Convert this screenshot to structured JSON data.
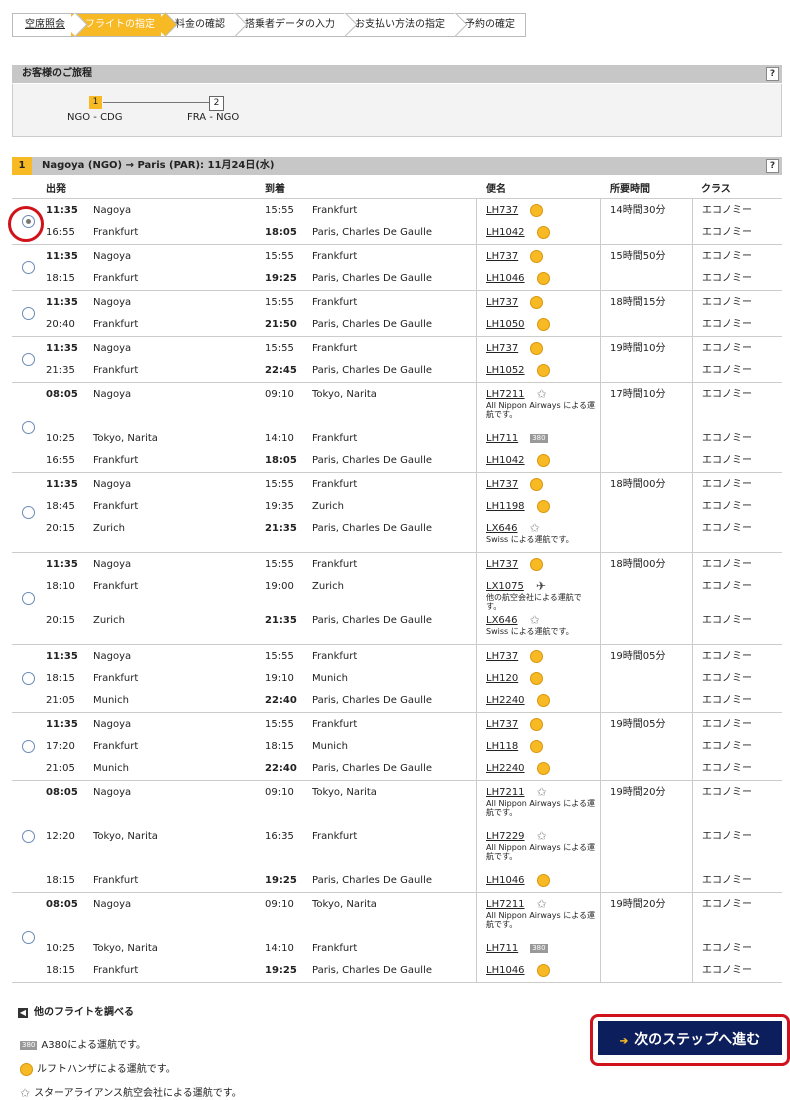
{
  "steps": [
    "空席照会",
    "フライトの指定",
    "料金の確認",
    "搭乗者データの入力",
    "お支払い方法の指定",
    "予約の確定"
  ],
  "itinerary": {
    "title": "お客様のご旅程",
    "help": "?",
    "segments": [
      {
        "num": "1",
        "route": "NGO - CDG"
      },
      {
        "num": "2",
        "route": "FRA - NGO"
      }
    ]
  },
  "flight_table": {
    "num": "1",
    "title": "Nagoya (NGO) → Paris (PAR):  11月24日(水)",
    "help": "?",
    "columns": {
      "dep": "出発",
      "arr": "到着",
      "flight": "便名",
      "duration": "所要時間",
      "class": "クラス"
    }
  },
  "options": [
    {
      "selected": true,
      "duration": "14時間30分",
      "legs": [
        {
          "dep_time": "11:35",
          "dep_city": "Nagoya",
          "arr_time": "15:55",
          "arr_city": "Frankfurt",
          "flight": "LH737",
          "icon": "lufthansa-icon",
          "class": "エコノミー",
          "dep_bold": true
        },
        {
          "dep_time": "16:55",
          "dep_city": "Frankfurt",
          "arr_time": "18:05",
          "arr_city": "Paris, Charles De Gaulle",
          "flight": "LH1042",
          "icon": "lufthansa-icon",
          "class": "エコノミー",
          "arr_bold": true
        }
      ]
    },
    {
      "selected": false,
      "duration": "15時間50分",
      "legs": [
        {
          "dep_time": "11:35",
          "dep_city": "Nagoya",
          "arr_time": "15:55",
          "arr_city": "Frankfurt",
          "flight": "LH737",
          "icon": "lufthansa-icon",
          "class": "エコノミー",
          "dep_bold": true
        },
        {
          "dep_time": "18:15",
          "dep_city": "Frankfurt",
          "arr_time": "19:25",
          "arr_city": "Paris, Charles De Gaulle",
          "flight": "LH1046",
          "icon": "lufthansa-icon",
          "class": "エコノミー",
          "arr_bold": true
        }
      ]
    },
    {
      "selected": false,
      "duration": "18時間15分",
      "legs": [
        {
          "dep_time": "11:35",
          "dep_city": "Nagoya",
          "arr_time": "15:55",
          "arr_city": "Frankfurt",
          "flight": "LH737",
          "icon": "lufthansa-icon",
          "class": "エコノミー",
          "dep_bold": true
        },
        {
          "dep_time": "20:40",
          "dep_city": "Frankfurt",
          "arr_time": "21:50",
          "arr_city": "Paris, Charles De Gaulle",
          "flight": "LH1050",
          "icon": "lufthansa-icon",
          "class": "エコノミー",
          "arr_bold": true
        }
      ]
    },
    {
      "selected": false,
      "duration": "19時間10分",
      "legs": [
        {
          "dep_time": "11:35",
          "dep_city": "Nagoya",
          "arr_time": "15:55",
          "arr_city": "Frankfurt",
          "flight": "LH737",
          "icon": "lufthansa-icon",
          "class": "エコノミー",
          "dep_bold": true
        },
        {
          "dep_time": "21:35",
          "dep_city": "Frankfurt",
          "arr_time": "22:45",
          "arr_city": "Paris, Charles De Gaulle",
          "flight": "LH1052",
          "icon": "lufthansa-icon",
          "class": "エコノミー",
          "arr_bold": true
        }
      ]
    },
    {
      "selected": false,
      "duration": "17時間10分",
      "legs": [
        {
          "dep_time": "08:05",
          "dep_city": "Nagoya",
          "arr_time": "09:10",
          "arr_city": "Tokyo, Narita",
          "flight": "LH7211",
          "icon": "star-alliance-icon",
          "note": "All Nippon Airways による運航です。",
          "class": "エコノミー",
          "dep_bold": true
        },
        {
          "dep_time": "10:25",
          "dep_city": "Tokyo, Narita",
          "arr_time": "14:10",
          "arr_city": "Frankfurt",
          "flight": "LH711",
          "icon": "a380-icon",
          "class": "エコノミー"
        },
        {
          "dep_time": "16:55",
          "dep_city": "Frankfurt",
          "arr_time": "18:05",
          "arr_city": "Paris, Charles De Gaulle",
          "flight": "LH1042",
          "icon": "lufthansa-icon",
          "class": "エコノミー",
          "arr_bold": true
        }
      ]
    },
    {
      "selected": false,
      "duration": "18時間00分",
      "legs": [
        {
          "dep_time": "11:35",
          "dep_city": "Nagoya",
          "arr_time": "15:55",
          "arr_city": "Frankfurt",
          "flight": "LH737",
          "icon": "lufthansa-icon",
          "class": "エコノミー",
          "dep_bold": true
        },
        {
          "dep_time": "18:45",
          "dep_city": "Frankfurt",
          "arr_time": "19:35",
          "arr_city": "Zurich",
          "flight": "LH1198",
          "icon": "lufthansa-icon",
          "class": "エコノミー"
        },
        {
          "dep_time": "20:15",
          "dep_city": "Zurich",
          "arr_time": "21:35",
          "arr_city": "Paris, Charles De Gaulle",
          "flight": "LX646",
          "icon": "star-alliance-icon",
          "note": "Swiss による運航です。",
          "class": "エコノミー",
          "arr_bold": true
        }
      ]
    },
    {
      "selected": false,
      "duration": "18時間00分",
      "legs": [
        {
          "dep_time": "11:35",
          "dep_city": "Nagoya",
          "arr_time": "15:55",
          "arr_city": "Frankfurt",
          "flight": "LH737",
          "icon": "lufthansa-icon",
          "class": "エコノミー",
          "dep_bold": true
        },
        {
          "dep_time": "18:10",
          "dep_city": "Frankfurt",
          "arr_time": "19:00",
          "arr_city": "Zurich",
          "flight": "LX1075",
          "icon": "plane-icon",
          "note": "他の航空会社による運航です。",
          "class": "エコノミー"
        },
        {
          "dep_time": "20:15",
          "dep_city": "Zurich",
          "arr_time": "21:35",
          "arr_city": "Paris, Charles De Gaulle",
          "flight": "LX646",
          "icon": "star-alliance-icon",
          "note": "Swiss による運航です。",
          "class": "エコノミー",
          "arr_bold": true
        }
      ]
    },
    {
      "selected": false,
      "duration": "19時間05分",
      "legs": [
        {
          "dep_time": "11:35",
          "dep_city": "Nagoya",
          "arr_time": "15:55",
          "arr_city": "Frankfurt",
          "flight": "LH737",
          "icon": "lufthansa-icon",
          "class": "エコノミー",
          "dep_bold": true
        },
        {
          "dep_time": "18:15",
          "dep_city": "Frankfurt",
          "arr_time": "19:10",
          "arr_city": "Munich",
          "flight": "LH120",
          "icon": "lufthansa-icon",
          "class": "エコノミー"
        },
        {
          "dep_time": "21:05",
          "dep_city": "Munich",
          "arr_time": "22:40",
          "arr_city": "Paris, Charles De Gaulle",
          "flight": "LH2240",
          "icon": "lufthansa-icon",
          "class": "エコノミー",
          "arr_bold": true
        }
      ]
    },
    {
      "selected": false,
      "duration": "19時間05分",
      "legs": [
        {
          "dep_time": "11:35",
          "dep_city": "Nagoya",
          "arr_time": "15:55",
          "arr_city": "Frankfurt",
          "flight": "LH737",
          "icon": "lufthansa-icon",
          "class": "エコノミー",
          "dep_bold": true
        },
        {
          "dep_time": "17:20",
          "dep_city": "Frankfurt",
          "arr_time": "18:15",
          "arr_city": "Munich",
          "flight": "LH118",
          "icon": "lufthansa-icon",
          "class": "エコノミー"
        },
        {
          "dep_time": "21:05",
          "dep_city": "Munich",
          "arr_time": "22:40",
          "arr_city": "Paris, Charles De Gaulle",
          "flight": "LH2240",
          "icon": "lufthansa-icon",
          "class": "エコノミー",
          "arr_bold": true
        }
      ]
    },
    {
      "selected": false,
      "duration": "19時間20分",
      "legs": [
        {
          "dep_time": "08:05",
          "dep_city": "Nagoya",
          "arr_time": "09:10",
          "arr_city": "Tokyo, Narita",
          "flight": "LH7211",
          "icon": "star-alliance-icon",
          "note": "All Nippon Airways による運航です。",
          "class": "エコノミー",
          "dep_bold": true
        },
        {
          "dep_time": "12:20",
          "dep_city": "Tokyo, Narita",
          "arr_time": "16:35",
          "arr_city": "Frankfurt",
          "flight": "LH7229",
          "icon": "star-alliance-icon",
          "note": "All Nippon Airways による運航です。",
          "class": "エコノミー"
        },
        {
          "dep_time": "18:15",
          "dep_city": "Frankfurt",
          "arr_time": "19:25",
          "arr_city": "Paris, Charles De Gaulle",
          "flight": "LH1046",
          "icon": "lufthansa-icon",
          "class": "エコノミー",
          "arr_bold": true
        }
      ]
    },
    {
      "selected": false,
      "duration": "19時間20分",
      "legs": [
        {
          "dep_time": "08:05",
          "dep_city": "Nagoya",
          "arr_time": "09:10",
          "arr_city": "Tokyo, Narita",
          "flight": "LH7211",
          "icon": "star-alliance-icon",
          "note": "All Nippon Airways による運航です。",
          "class": "エコノミー",
          "dep_bold": true
        },
        {
          "dep_time": "10:25",
          "dep_city": "Tokyo, Narita",
          "arr_time": "14:10",
          "arr_city": "Frankfurt",
          "flight": "LH711",
          "icon": "a380-icon",
          "class": "エコノミー"
        },
        {
          "dep_time": "18:15",
          "dep_city": "Frankfurt",
          "arr_time": "19:25",
          "arr_city": "Paris, Charles De Gaulle",
          "flight": "LH1046",
          "icon": "lufthansa-icon",
          "class": "エコノミー",
          "arr_bold": true
        }
      ]
    }
  ],
  "other_flights": "他のフライトを調べる",
  "legend": {
    "a380_badge": "380",
    "a380": "A380による運航です。",
    "lufthansa": "ルフトハンザによる運航です。",
    "star": "スターアライアンス航空会社による運航です。"
  },
  "next_button": "次のステップへ進む",
  "colors": {
    "accent": "#f7b924",
    "button": "#0c1e5b",
    "highlight": "#d0121b"
  }
}
